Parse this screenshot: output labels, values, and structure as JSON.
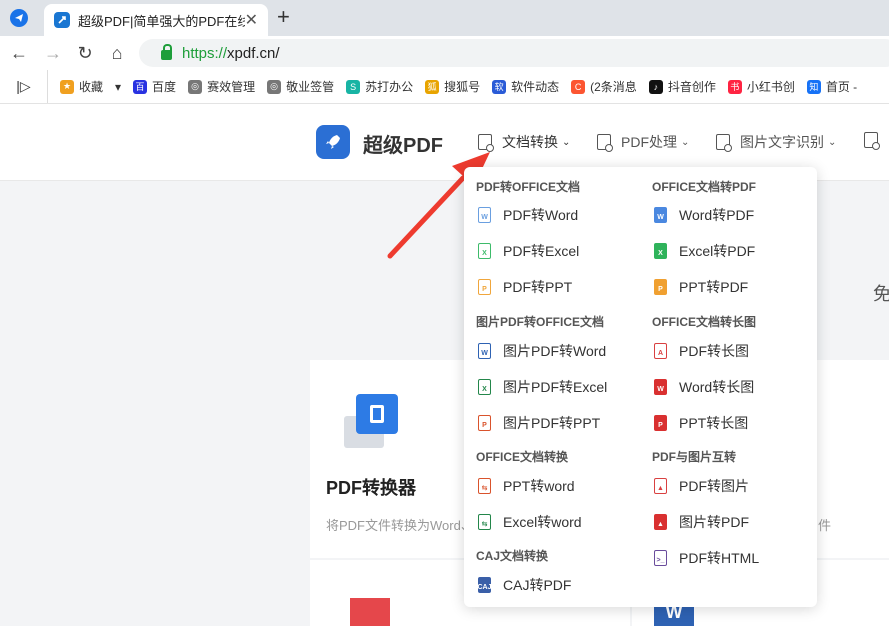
{
  "browser": {
    "tab_title": "超级PDF|简单强大的PDF在线",
    "tab_close": "✕",
    "new_tab": "+",
    "url_scheme": "https://",
    "url_rest": "xpdf.cn/",
    "back": "←",
    "forward": "→",
    "reload": "↻",
    "home": "⌂"
  },
  "bookmarks": {
    "side_toggle": "|▷",
    "items": [
      {
        "label": "收藏",
        "icon": "star-icon",
        "color": "#f0a020",
        "glyph": "★"
      },
      {
        "label": "▾",
        "icon": "",
        "color": "",
        "glyph": ""
      },
      {
        "label": "百度",
        "icon": "baidu-icon",
        "color": "#2932e1",
        "glyph": "百"
      },
      {
        "label": "赛效管理",
        "icon": "globe-icon",
        "color": "#777777",
        "glyph": "◎"
      },
      {
        "label": "敬业签管",
        "icon": "globe-icon",
        "color": "#777777",
        "glyph": "◎"
      },
      {
        "label": "苏打办公",
        "icon": "suda-icon",
        "color": "#18b4a4",
        "glyph": "S"
      },
      {
        "label": "搜狐号",
        "icon": "sohu-icon",
        "color": "#e8a400",
        "glyph": "狐"
      },
      {
        "label": "软件动态",
        "icon": "software-icon",
        "color": "#2a5bd7",
        "glyph": "软"
      },
      {
        "label": "(2条消息",
        "icon": "csdn-icon",
        "color": "#fc5531",
        "glyph": "C"
      },
      {
        "label": "抖音创作",
        "icon": "douyin-icon",
        "color": "#111111",
        "glyph": "♪"
      },
      {
        "label": "小红书创",
        "icon": "xiaohongshu-icon",
        "color": "#ff2442",
        "glyph": "书"
      },
      {
        "label": "首页 -",
        "icon": "zhihu-icon",
        "color": "#1772f6",
        "glyph": "知"
      }
    ]
  },
  "header": {
    "brand": "超级PDF",
    "nav": [
      {
        "label": "文档转换",
        "chevron": "⌄"
      },
      {
        "label": "PDF处理",
        "chevron": "⌄"
      },
      {
        "label": "图片文字识别",
        "chevron": "⌄"
      }
    ]
  },
  "page": {
    "side_text": "免",
    "card_title": "PDF转换器",
    "card_desc": "将PDF文件转换为Word、",
    "card_desc_right": "件"
  },
  "dropdown": {
    "left": [
      {
        "section": "PDF转OFFICE文档",
        "items": [
          {
            "label": "PDF转Word",
            "color": "#6a9fe0",
            "tag": "W",
            "solid": false
          },
          {
            "label": "PDF转Excel",
            "color": "#3dbb6a",
            "tag": "X",
            "solid": false
          },
          {
            "label": "PDF转PPT",
            "color": "#f0a63c",
            "tag": "P",
            "solid": false
          }
        ]
      },
      {
        "section": "图片PDF转OFFICE文档",
        "items": [
          {
            "label": "图片PDF转Word",
            "color": "#2e62b3",
            "tag": "W",
            "solid": false
          },
          {
            "label": "图片PDF转Excel",
            "color": "#23864a",
            "tag": "X",
            "solid": false
          },
          {
            "label": "图片PDF转PPT",
            "color": "#d9532c",
            "tag": "P",
            "solid": false
          }
        ]
      },
      {
        "section": "OFFICE文档转换",
        "items": [
          {
            "label": "PPT转word",
            "color": "#d9532c",
            "tag": "⇆",
            "solid": false
          },
          {
            "label": "Excel转word",
            "color": "#23864a",
            "tag": "⇆",
            "solid": false
          }
        ]
      },
      {
        "section": "CAJ文档转换",
        "items": [
          {
            "label": "CAJ转PDF",
            "color": "#3a5fa8",
            "tag": "CAJ",
            "solid": true
          }
        ]
      }
    ],
    "right": [
      {
        "section": "OFFICE文档转PDF",
        "items": [
          {
            "label": "Word转PDF",
            "color": "#4a88e0",
            "tag": "W",
            "solid": true
          },
          {
            "label": "Excel转PDF",
            "color": "#2fb35b",
            "tag": "X",
            "solid": true
          },
          {
            "label": "PPT转PDF",
            "color": "#f0a030",
            "tag": "P",
            "solid": true
          }
        ]
      },
      {
        "section": "OFFICE文档转长图",
        "items": [
          {
            "label": "PDF转长图",
            "color": "#d94040",
            "tag": "A",
            "solid": false
          },
          {
            "label": "Word转长图",
            "color": "#d93030",
            "tag": "W",
            "solid": true
          },
          {
            "label": "PPT转长图",
            "color": "#d93030",
            "tag": "P",
            "solid": true
          }
        ]
      },
      {
        "section": "PDF与图片互转",
        "items": [
          {
            "label": "PDF转图片",
            "color": "#d94040",
            "tag": "▲",
            "solid": false
          },
          {
            "label": "图片转PDF",
            "color": "#d93030",
            "tag": "▲",
            "solid": true
          },
          {
            "label": "PDF转HTML",
            "color": "#6a4c9c",
            "tag": ">_",
            "solid": false
          }
        ]
      }
    ]
  },
  "colors": {
    "brand_blue": "#2b6fd4",
    "arrow_red": "#ee3b2f",
    "https_green": "#1e9e3a"
  }
}
